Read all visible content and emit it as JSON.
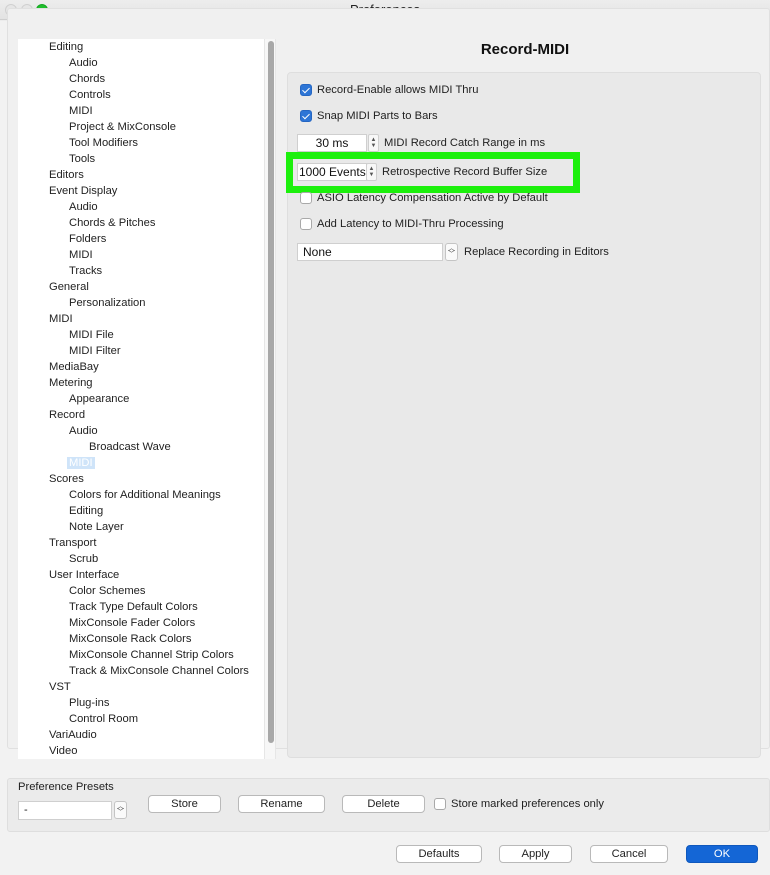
{
  "window": {
    "title": "Preferences",
    "traffic_lights": [
      "close",
      "minimize",
      "maximize"
    ]
  },
  "tree": {
    "items": [
      {
        "label": "Editing",
        "level": 0
      },
      {
        "label": "Audio",
        "level": 1
      },
      {
        "label": "Chords",
        "level": 1
      },
      {
        "label": "Controls",
        "level": 1
      },
      {
        "label": "MIDI",
        "level": 1
      },
      {
        "label": "Project & MixConsole",
        "level": 1
      },
      {
        "label": "Tool Modifiers",
        "level": 1
      },
      {
        "label": "Tools",
        "level": 1
      },
      {
        "label": "Editors",
        "level": 0
      },
      {
        "label": "Event Display",
        "level": 0
      },
      {
        "label": "Audio",
        "level": 1
      },
      {
        "label": "Chords & Pitches",
        "level": 1
      },
      {
        "label": "Folders",
        "level": 1
      },
      {
        "label": "MIDI",
        "level": 1
      },
      {
        "label": "Tracks",
        "level": 1
      },
      {
        "label": "General",
        "level": 0
      },
      {
        "label": "Personalization",
        "level": 1
      },
      {
        "label": "MIDI",
        "level": 0
      },
      {
        "label": "MIDI File",
        "level": 1
      },
      {
        "label": "MIDI Filter",
        "level": 1
      },
      {
        "label": "MediaBay",
        "level": 0
      },
      {
        "label": "Metering",
        "level": 0
      },
      {
        "label": "Appearance",
        "level": 1
      },
      {
        "label": "Record",
        "level": 0
      },
      {
        "label": "Audio",
        "level": 1
      },
      {
        "label": "Broadcast Wave",
        "level": 2
      },
      {
        "label": "MIDI",
        "level": 1,
        "selected": true
      },
      {
        "label": "Scores",
        "level": 0
      },
      {
        "label": "Colors for Additional Meanings",
        "level": 1
      },
      {
        "label": "Editing",
        "level": 1
      },
      {
        "label": "Note Layer",
        "level": 1
      },
      {
        "label": "Transport",
        "level": 0
      },
      {
        "label": "Scrub",
        "level": 1
      },
      {
        "label": "User Interface",
        "level": 0
      },
      {
        "label": "Color Schemes",
        "level": 1
      },
      {
        "label": "Track Type Default Colors",
        "level": 1
      },
      {
        "label": "MixConsole Fader Colors",
        "level": 1
      },
      {
        "label": "MixConsole Rack Colors",
        "level": 1
      },
      {
        "label": "MixConsole Channel Strip Colors",
        "level": 1
      },
      {
        "label": "Track & MixConsole Channel Colors",
        "level": 1
      },
      {
        "label": "VST",
        "level": 0
      },
      {
        "label": "Plug-ins",
        "level": 1
      },
      {
        "label": "Control Room",
        "level": 1
      },
      {
        "label": "VariAudio",
        "level": 0
      },
      {
        "label": "Video",
        "level": 0
      }
    ]
  },
  "panel": {
    "title": "Record-MIDI",
    "options": {
      "record_enable_midi_thru": {
        "label": "Record-Enable allows MIDI Thru",
        "checked": true
      },
      "snap_midi_parts": {
        "label": "Snap MIDI Parts to Bars",
        "checked": true
      },
      "catch_range": {
        "value": "30 ms",
        "label": "MIDI Record Catch Range in ms"
      },
      "retro_buffer": {
        "value": "1000 Events",
        "label": "Retrospective Record Buffer Size",
        "highlighted": true
      },
      "asio_latency": {
        "label": "ASIO Latency Compensation Active by Default",
        "checked": false
      },
      "add_latency": {
        "label": "Add Latency to MIDI-Thru Processing",
        "checked": false
      },
      "replace_recording": {
        "value": "None",
        "label": "Replace Recording in Editors"
      }
    }
  },
  "presets": {
    "label": "Preference Presets",
    "selected": "-",
    "store": "Store",
    "rename": "Rename",
    "delete": "Delete",
    "store_marked_only": {
      "label": "Store marked preferences only",
      "checked": false
    }
  },
  "footer": {
    "defaults": "Defaults",
    "apply": "Apply",
    "cancel": "Cancel",
    "ok": "OK"
  },
  "colors": {
    "highlight": "#1cf00c",
    "accent": "#1466d6",
    "selection": "#cfe4f9"
  }
}
